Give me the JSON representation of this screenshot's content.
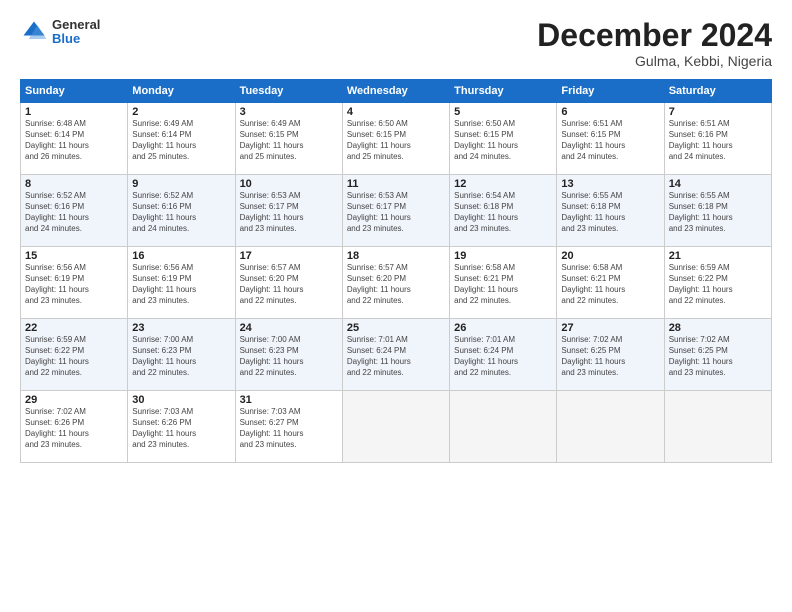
{
  "logo": {
    "general": "General",
    "blue": "Blue"
  },
  "title": "December 2024",
  "subtitle": "Gulma, Kebbi, Nigeria",
  "days_header": [
    "Sunday",
    "Monday",
    "Tuesday",
    "Wednesday",
    "Thursday",
    "Friday",
    "Saturday"
  ],
  "weeks": [
    [
      {
        "day": "1",
        "info": "Sunrise: 6:48 AM\nSunset: 6:14 PM\nDaylight: 11 hours\nand 26 minutes."
      },
      {
        "day": "2",
        "info": "Sunrise: 6:49 AM\nSunset: 6:14 PM\nDaylight: 11 hours\nand 25 minutes."
      },
      {
        "day": "3",
        "info": "Sunrise: 6:49 AM\nSunset: 6:15 PM\nDaylight: 11 hours\nand 25 minutes."
      },
      {
        "day": "4",
        "info": "Sunrise: 6:50 AM\nSunset: 6:15 PM\nDaylight: 11 hours\nand 25 minutes."
      },
      {
        "day": "5",
        "info": "Sunrise: 6:50 AM\nSunset: 6:15 PM\nDaylight: 11 hours\nand 24 minutes."
      },
      {
        "day": "6",
        "info": "Sunrise: 6:51 AM\nSunset: 6:15 PM\nDaylight: 11 hours\nand 24 minutes."
      },
      {
        "day": "7",
        "info": "Sunrise: 6:51 AM\nSunset: 6:16 PM\nDaylight: 11 hours\nand 24 minutes."
      }
    ],
    [
      {
        "day": "8",
        "info": "Sunrise: 6:52 AM\nSunset: 6:16 PM\nDaylight: 11 hours\nand 24 minutes."
      },
      {
        "day": "9",
        "info": "Sunrise: 6:52 AM\nSunset: 6:16 PM\nDaylight: 11 hours\nand 24 minutes."
      },
      {
        "day": "10",
        "info": "Sunrise: 6:53 AM\nSunset: 6:17 PM\nDaylight: 11 hours\nand 23 minutes."
      },
      {
        "day": "11",
        "info": "Sunrise: 6:53 AM\nSunset: 6:17 PM\nDaylight: 11 hours\nand 23 minutes."
      },
      {
        "day": "12",
        "info": "Sunrise: 6:54 AM\nSunset: 6:18 PM\nDaylight: 11 hours\nand 23 minutes."
      },
      {
        "day": "13",
        "info": "Sunrise: 6:55 AM\nSunset: 6:18 PM\nDaylight: 11 hours\nand 23 minutes."
      },
      {
        "day": "14",
        "info": "Sunrise: 6:55 AM\nSunset: 6:18 PM\nDaylight: 11 hours\nand 23 minutes."
      }
    ],
    [
      {
        "day": "15",
        "info": "Sunrise: 6:56 AM\nSunset: 6:19 PM\nDaylight: 11 hours\nand 23 minutes."
      },
      {
        "day": "16",
        "info": "Sunrise: 6:56 AM\nSunset: 6:19 PM\nDaylight: 11 hours\nand 23 minutes."
      },
      {
        "day": "17",
        "info": "Sunrise: 6:57 AM\nSunset: 6:20 PM\nDaylight: 11 hours\nand 22 minutes."
      },
      {
        "day": "18",
        "info": "Sunrise: 6:57 AM\nSunset: 6:20 PM\nDaylight: 11 hours\nand 22 minutes."
      },
      {
        "day": "19",
        "info": "Sunrise: 6:58 AM\nSunset: 6:21 PM\nDaylight: 11 hours\nand 22 minutes."
      },
      {
        "day": "20",
        "info": "Sunrise: 6:58 AM\nSunset: 6:21 PM\nDaylight: 11 hours\nand 22 minutes."
      },
      {
        "day": "21",
        "info": "Sunrise: 6:59 AM\nSunset: 6:22 PM\nDaylight: 11 hours\nand 22 minutes."
      }
    ],
    [
      {
        "day": "22",
        "info": "Sunrise: 6:59 AM\nSunset: 6:22 PM\nDaylight: 11 hours\nand 22 minutes."
      },
      {
        "day": "23",
        "info": "Sunrise: 7:00 AM\nSunset: 6:23 PM\nDaylight: 11 hours\nand 22 minutes."
      },
      {
        "day": "24",
        "info": "Sunrise: 7:00 AM\nSunset: 6:23 PM\nDaylight: 11 hours\nand 22 minutes."
      },
      {
        "day": "25",
        "info": "Sunrise: 7:01 AM\nSunset: 6:24 PM\nDaylight: 11 hours\nand 22 minutes."
      },
      {
        "day": "26",
        "info": "Sunrise: 7:01 AM\nSunset: 6:24 PM\nDaylight: 11 hours\nand 22 minutes."
      },
      {
        "day": "27",
        "info": "Sunrise: 7:02 AM\nSunset: 6:25 PM\nDaylight: 11 hours\nand 23 minutes."
      },
      {
        "day": "28",
        "info": "Sunrise: 7:02 AM\nSunset: 6:25 PM\nDaylight: 11 hours\nand 23 minutes."
      }
    ],
    [
      {
        "day": "29",
        "info": "Sunrise: 7:02 AM\nSunset: 6:26 PM\nDaylight: 11 hours\nand 23 minutes."
      },
      {
        "day": "30",
        "info": "Sunrise: 7:03 AM\nSunset: 6:26 PM\nDaylight: 11 hours\nand 23 minutes."
      },
      {
        "day": "31",
        "info": "Sunrise: 7:03 AM\nSunset: 6:27 PM\nDaylight: 11 hours\nand 23 minutes."
      },
      null,
      null,
      null,
      null
    ]
  ]
}
